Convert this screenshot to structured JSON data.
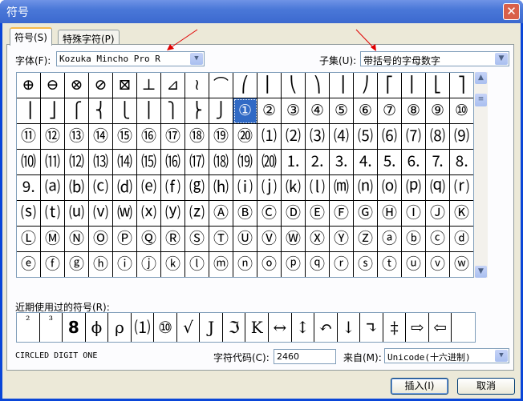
{
  "window": {
    "title": "符号",
    "close_icon": "close-icon"
  },
  "tabs": [
    {
      "label": "符号(S)",
      "active": true
    },
    {
      "label": "特殊字符(P)",
      "active": false
    }
  ],
  "font": {
    "label": "字体(F):",
    "value": "Kozuka Mincho Pro R"
  },
  "subset": {
    "label": "子集(U):",
    "value": "带括号的字母数字"
  },
  "symbols": [
    "⊕",
    "⊖",
    "⊗",
    "⊘",
    "⊠",
    "⊥",
    "⊿",
    "≀",
    "⌒",
    "⎛",
    "⎜",
    "⎝",
    "⎞",
    "⎟",
    "⎠",
    "⎡",
    "⎢",
    "⎣",
    "⎤",
    "⎥",
    "⎦",
    "⎧",
    "⎨",
    "⎩",
    "⎪",
    "⎫",
    "⎬",
    "⎭",
    "①",
    "②",
    "③",
    "④",
    "⑤",
    "⑥",
    "⑦",
    "⑧",
    "⑨",
    "⑩",
    "⑪",
    "⑫",
    "⑬",
    "⑭",
    "⑮",
    "⑯",
    "⑰",
    "⑱",
    "⑲",
    "⑳",
    "⑴",
    "⑵",
    "⑶",
    "⑷",
    "⑸",
    "⑹",
    "⑺",
    "⑻",
    "⑼",
    "⑽",
    "⑾",
    "⑿",
    "⒀",
    "⒁",
    "⒂",
    "⒃",
    "⒄",
    "⒅",
    "⒆",
    "⒇",
    "⒈",
    "⒉",
    "⒊",
    "⒋",
    "⒌",
    "⒍",
    "⒎",
    "⒏",
    "⒐",
    "⒜",
    "⒝",
    "⒞",
    "⒟",
    "⒠",
    "⒡",
    "⒢",
    "⒣",
    "⒤",
    "⒥",
    "⒦",
    "⒧",
    "⒨",
    "⒩",
    "⒪",
    "⒫",
    "⒬",
    "⒭",
    "⒮",
    "⒯",
    "⒰",
    "⒱",
    "⒲",
    "⒳",
    "⒴",
    "⒵",
    "Ⓐ",
    "Ⓑ",
    "Ⓒ",
    "Ⓓ",
    "Ⓔ",
    "Ⓕ",
    "Ⓖ",
    "Ⓗ",
    "Ⓘ",
    "Ⓙ",
    "Ⓚ",
    "Ⓛ",
    "Ⓜ",
    "Ⓝ",
    "Ⓞ",
    "Ⓟ",
    "Ⓠ",
    "Ⓡ",
    "Ⓢ",
    "Ⓣ",
    "Ⓤ",
    "Ⓥ",
    "Ⓦ",
    "Ⓧ",
    "Ⓨ",
    "Ⓩ",
    "ⓐ",
    "ⓑ",
    "ⓒ",
    "ⓓ",
    "ⓔ",
    "ⓕ",
    "ⓖ",
    "ⓗ",
    "ⓘ",
    "ⓙ",
    "ⓚ",
    "ⓛ",
    "ⓜ",
    "ⓝ",
    "ⓞ",
    "ⓟ",
    "ⓠ",
    "ⓡ",
    "ⓢ",
    "ⓣ",
    "ⓤ",
    "ⓥ",
    "ⓦ"
  ],
  "selected_symbol": "①",
  "recent": {
    "label": "近期使用过的符号(R):",
    "items": [
      "²",
      "³",
      "8",
      "ϕ",
      "ρ",
      "⑴",
      "⑩",
      "√",
      "J",
      "ℑ",
      "K",
      "↔",
      "↕",
      "↶",
      "↓",
      "↴",
      "‡",
      "⇨",
      "⇦"
    ]
  },
  "char_name": "CIRCLED DIGIT ONE",
  "char_code": {
    "label": "字符代码(C):",
    "value": "2460"
  },
  "from": {
    "label": "来自(M):",
    "value": "Unicode(十六进制)"
  },
  "buttons": {
    "insert": "插入(I)",
    "cancel": "取消"
  },
  "colors": {
    "selection": "#316ac5",
    "annotation_arrow": "#e00000"
  }
}
